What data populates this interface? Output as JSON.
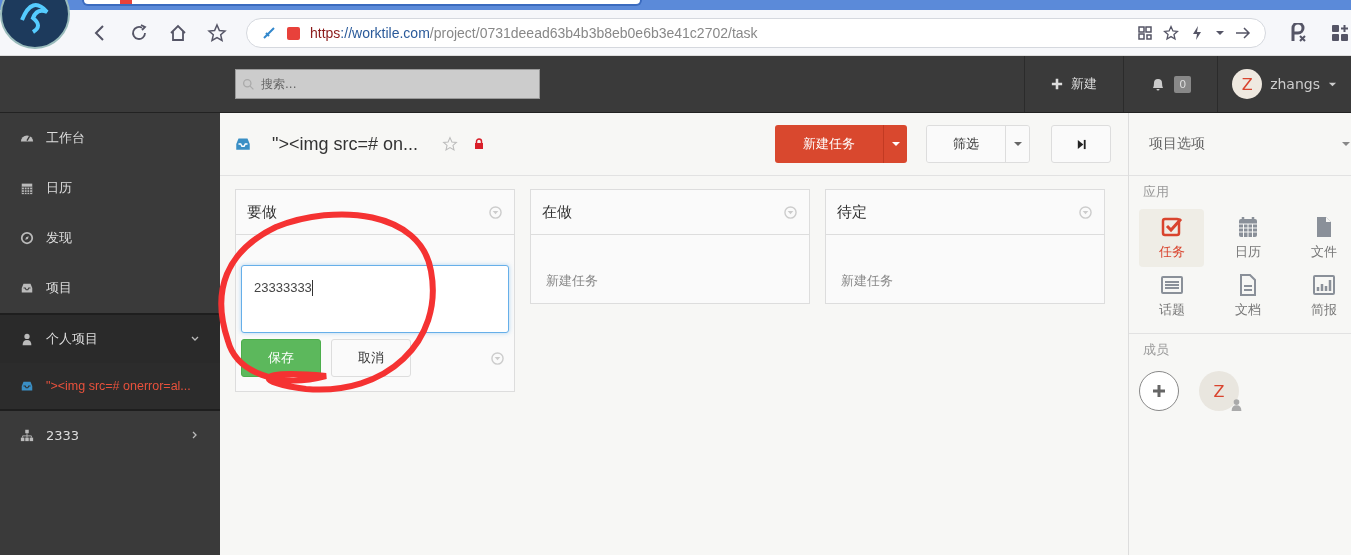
{
  "browser": {
    "url": {
      "scheme": "https",
      "host": "://worktile.com",
      "path": "/project/0731deead63b4b3b8eb0e6b3e41c2702/task"
    }
  },
  "header": {
    "search": {
      "placeholder": "搜索..."
    },
    "new_label": "新建",
    "notifications": "0",
    "avatar_letter": "Z",
    "user": "zhangs"
  },
  "sidebar": {
    "items": [
      {
        "label": "工作台"
      },
      {
        "label": "日历"
      },
      {
        "label": "发现"
      },
      {
        "label": "项目"
      }
    ],
    "groups": [
      {
        "label": "个人项目",
        "expanded": true,
        "children": [
          {
            "label": "\"><img src=# onerror=al...",
            "selected": true
          }
        ]
      },
      {
        "label": "2333",
        "expanded": false
      }
    ]
  },
  "project": {
    "title": "\"><img src=# on...",
    "starred": false,
    "locked": true,
    "new_task": "新建任务",
    "filter": "筛选"
  },
  "columns": [
    {
      "title": "要做",
      "editing": true,
      "draft": "23333333",
      "save": "保存",
      "cancel": "取消"
    },
    {
      "title": "在做",
      "editing": false,
      "add": "新建任务"
    },
    {
      "title": "待定",
      "editing": false,
      "add": "新建任务"
    }
  ],
  "panel": {
    "title": "项目选项",
    "apps_heading": "应用",
    "apps": [
      {
        "label": "任务",
        "selected": true
      },
      {
        "label": "日历",
        "selected": false
      },
      {
        "label": "文件",
        "selected": false
      },
      {
        "label": "话题",
        "selected": false
      },
      {
        "label": "文档",
        "selected": false
      },
      {
        "label": "简报",
        "selected": false
      }
    ],
    "members_heading": "成员",
    "members": [
      {
        "letter": "Z"
      }
    ]
  }
}
